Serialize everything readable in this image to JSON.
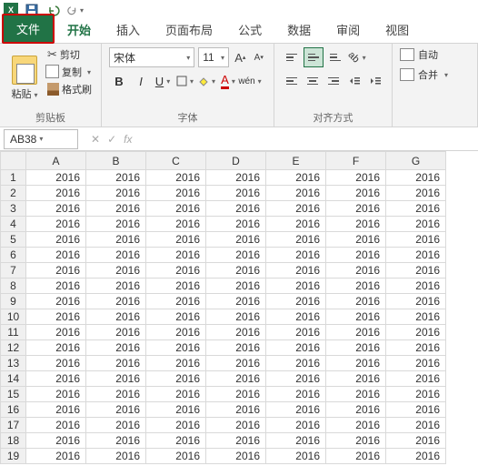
{
  "qat": {
    "save_title": "保存",
    "undo_title": "撤销",
    "redo_title": "恢复"
  },
  "tabs": {
    "file": "文件",
    "items": [
      "开始",
      "插入",
      "页面布局",
      "公式",
      "数据",
      "审阅",
      "视图"
    ],
    "active_index": 0
  },
  "ribbon": {
    "clipboard": {
      "label": "剪贴板",
      "paste": "粘贴",
      "cut": "剪切",
      "copy": "复制",
      "format_painter": "格式刷"
    },
    "font": {
      "label": "字体",
      "font_name": "宋体",
      "font_size": "11",
      "increase": "A",
      "decrease": "A"
    },
    "alignment": {
      "label": "对齐方式"
    },
    "wrap": {
      "auto_wrap": "自动",
      "merge": "合并"
    }
  },
  "name_box": "AB38",
  "fx_label": "fx",
  "columns": [
    "A",
    "B",
    "C",
    "D",
    "E",
    "F",
    "G"
  ],
  "rows": [
    1,
    2,
    3,
    4,
    5,
    6,
    7,
    8,
    9,
    10,
    11,
    12,
    13,
    14,
    15,
    16,
    17,
    18,
    19
  ],
  "cell_value": "2016"
}
